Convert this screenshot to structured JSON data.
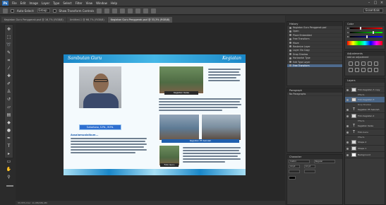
{
  "menubar": {
    "logo": "Ps",
    "items": [
      "File",
      "Edit",
      "Image",
      "Layer",
      "Type",
      "Select",
      "Filter",
      "View",
      "Window",
      "Help"
    ]
  },
  "options": {
    "auto_select_label": "Auto-Select:",
    "auto_select_value": "Group",
    "transform_label": "Show Transform Controls",
    "workspace": "Essentials"
  },
  "tabs": [
    {
      "label": "Kegiatan Guru Penggerak.psd @ 16,7% (RGB/8)",
      "active": false
    },
    {
      "label": "Untitled-1 @ 66,7% (RGB/8)",
      "active": false
    },
    {
      "label": "Kegiatan Guru Penggerak.psd @ 33,3% (RGB/8)",
      "active": true
    }
  ],
  "document": {
    "left_header": "Sambutan Guru",
    "right_header": "Kegiatan",
    "name_banner": "Suhartono, S.Pd., M.Pd.",
    "left_heading": "Assalamualaikum...",
    "caption_1": "Kegiatan Kelas",
    "caption_2": "Kegiatan P5 Sekolah",
    "caption_3": "Foto Guru"
  },
  "panels": {
    "history_title": "History",
    "history_rows": [
      "Kegiatan Guru Penggerak.psd",
      "Open",
      "Place Embedded",
      "Free Transform",
      "Move",
      "Rasterize Layer",
      "Layer Via Copy",
      "Drop Shadow",
      "Horizontal Type",
      "Edit Type Layer",
      "Free Transform"
    ],
    "paragraph_title": "Paragraph",
    "paragraph_label": "No Paragraphs",
    "color_title": "Color",
    "adjust_title": "Adjustments",
    "adjust_label": "Add an adjustment",
    "layers_title": "Layers",
    "character_title": "Character",
    "char_font": "Calibri",
    "char_style": "Regular",
    "char_size": "10 pt",
    "char_leading": "12 pt",
    "layers": [
      {
        "name": "Foto Kegiatan 3 copy",
        "kind": "image",
        "selected": false
      },
      {
        "name": "Effects",
        "kind": "sub"
      },
      {
        "name": "Foto Kegiatan 3",
        "kind": "image",
        "selected": true
      },
      {
        "name": "Drop Shadow",
        "kind": "sub"
      },
      {
        "name": "Kegiatan P5 Sekolah",
        "kind": "text",
        "selected": false
      },
      {
        "name": "Foto Kegiatan 2",
        "kind": "image",
        "selected": false
      },
      {
        "name": "Effects",
        "kind": "sub"
      },
      {
        "name": "Kegiatan Kelas",
        "kind": "text",
        "selected": false
      },
      {
        "name": "Foto Guru",
        "kind": "text",
        "selected": false
      },
      {
        "name": "Effects",
        "kind": "sub"
      },
      {
        "name": "Shape 2",
        "kind": "image",
        "selected": false
      },
      {
        "name": "Shape 1",
        "kind": "image",
        "selected": false
      },
      {
        "name": "Background",
        "kind": "image",
        "selected": false
      }
    ]
  },
  "status": "33,33%     Doc: 11,9M/189,4M"
}
